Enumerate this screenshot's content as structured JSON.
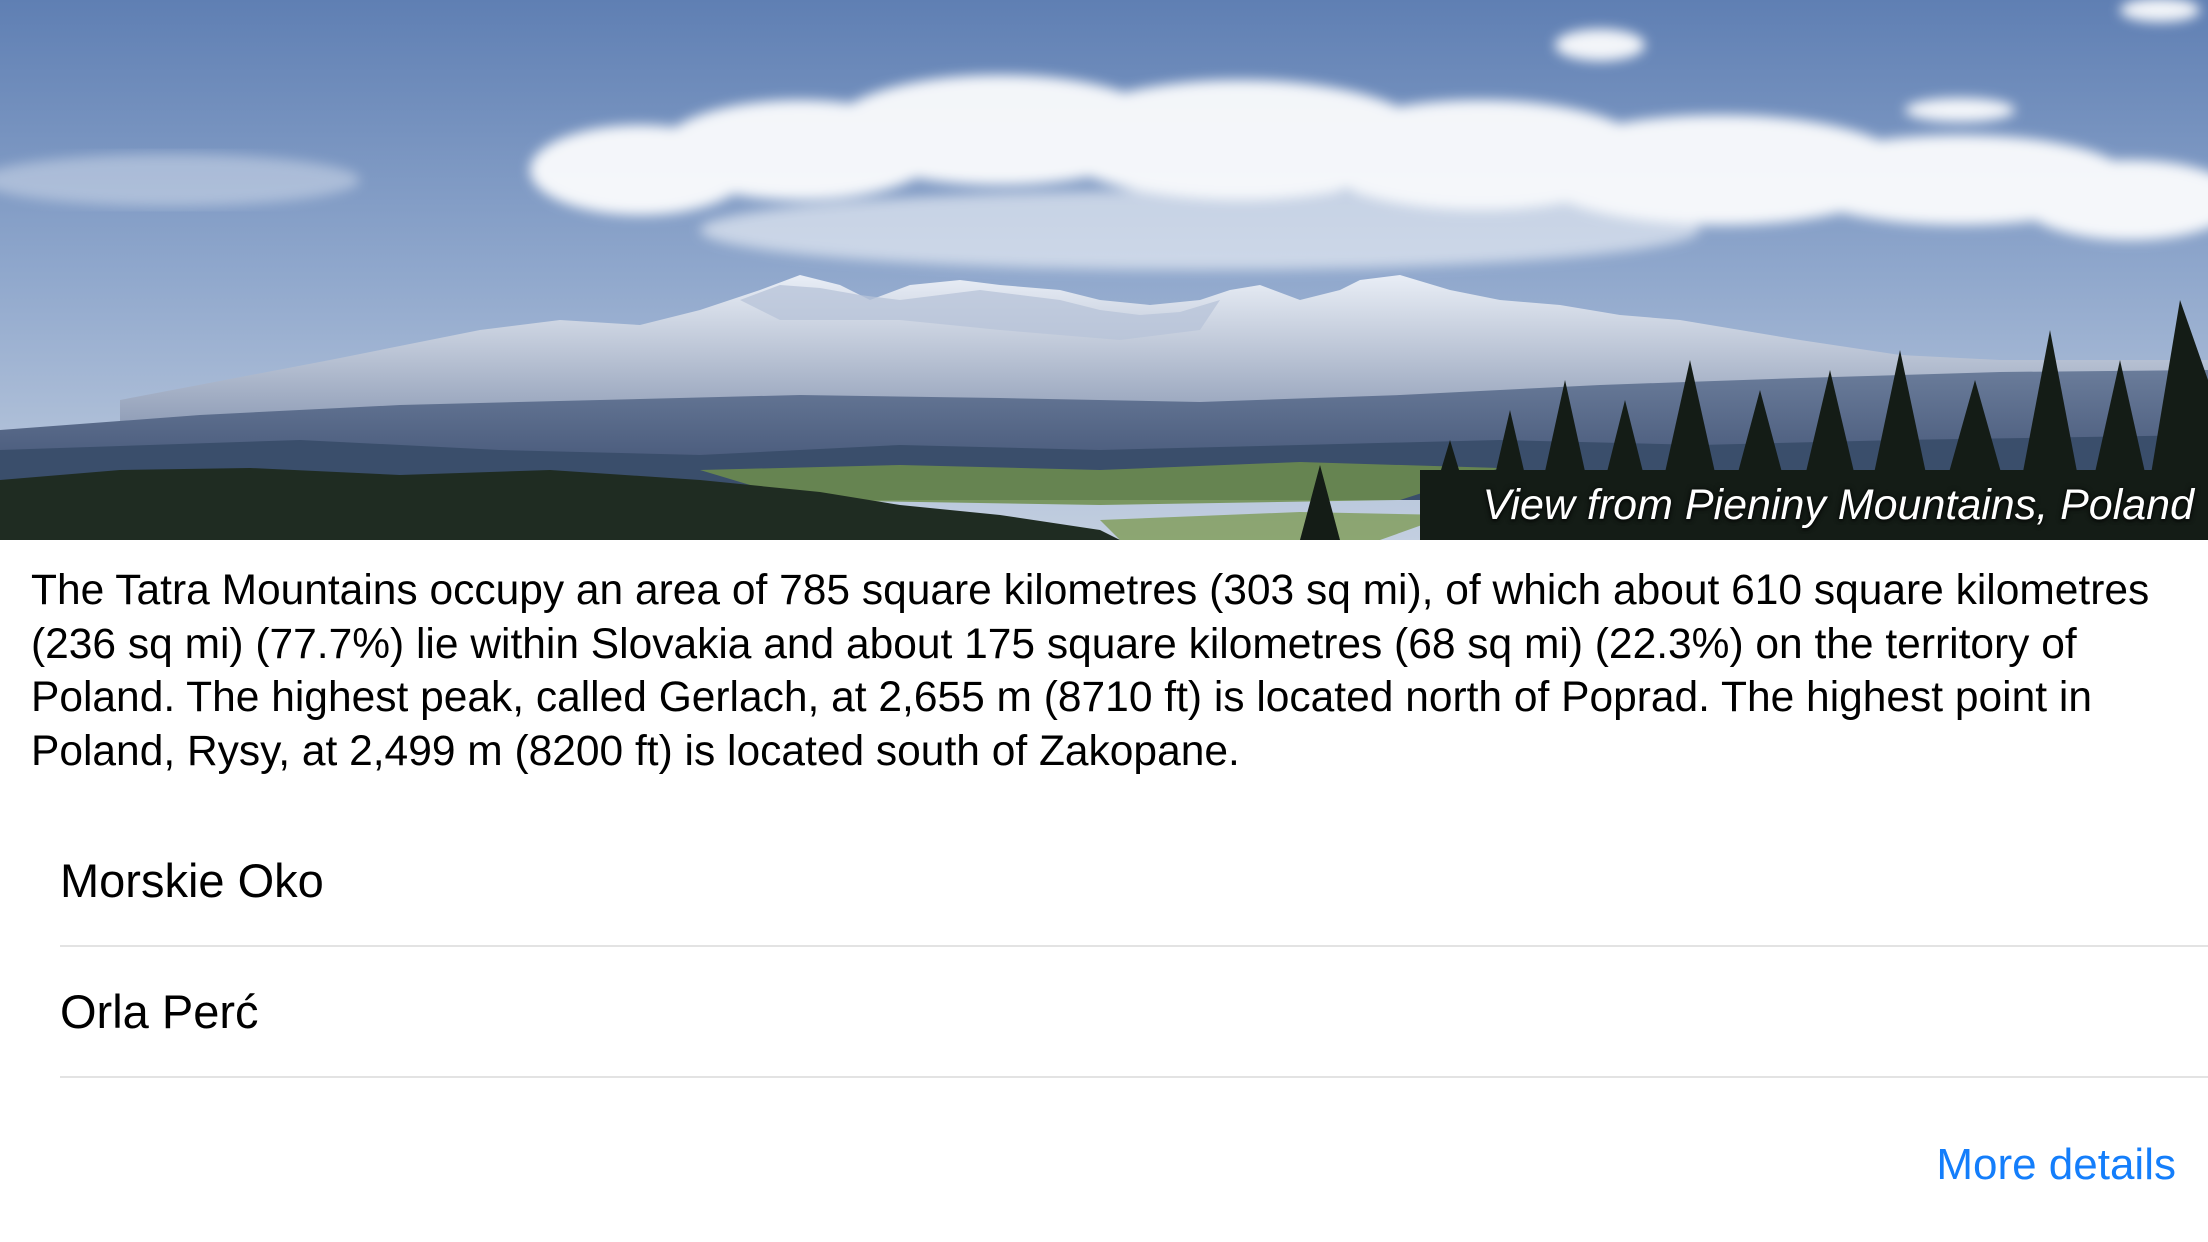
{
  "hero": {
    "caption": "View from Pieniny Mountains, Poland"
  },
  "description": "The Tatra Mountains occupy an area of 785 square kilometres (303 sq mi), of which about 610 square kilometres (236 sq mi) (77.7%) lie within Slovakia and about 175 square kilometres (68 sq mi) (22.3%) on the territory of Poland. The highest peak, called Gerlach, at 2,655 m (8710 ft) is located north of Poprad. The highest point in Poland, Rysy, at 2,499 m (8200 ft) is located south of Zakopane.",
  "places": [
    {
      "label": "Morskie Oko"
    },
    {
      "label": "Orla Perć"
    }
  ],
  "more_link": "More details",
  "colors": {
    "link": "#147efb",
    "separator": "#e3e3e3"
  }
}
